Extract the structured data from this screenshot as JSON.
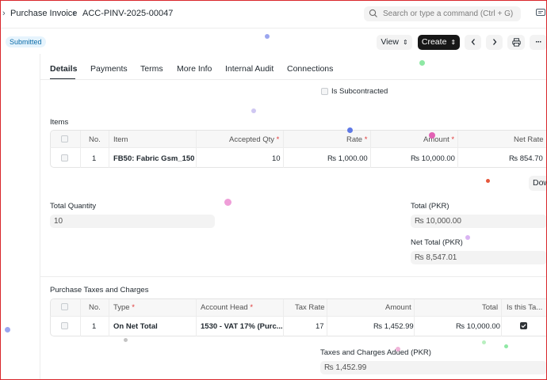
{
  "breadcrumb": {
    "doctype": "Purchase Invoice",
    "docname": "ACC-PINV-2025-00047"
  },
  "search": {
    "placeholder": "Search or type a command (Ctrl + G)"
  },
  "status": {
    "label": "Submitted"
  },
  "toolbar": {
    "view_label": "View",
    "create_label": "Create",
    "prev_icon": "chevron-left-icon",
    "next_icon": "chevron-right-icon",
    "print_icon": "printer-icon",
    "more_label": "···"
  },
  "tabs": [
    {
      "label": "Details",
      "active": true
    },
    {
      "label": "Payments"
    },
    {
      "label": "Terms"
    },
    {
      "label": "More Info"
    },
    {
      "label": "Internal Audit"
    },
    {
      "label": "Connections"
    }
  ],
  "is_subcontracted": {
    "label": "Is Subcontracted",
    "checked": false
  },
  "items": {
    "section_title": "Items",
    "headers": {
      "no": "No.",
      "item": "Item",
      "accepted_qty": "Accepted Qty",
      "rate": "Rate",
      "amount": "Amount",
      "net_rate": "Net Rate",
      "required_marker": "*"
    },
    "rows": [
      {
        "no": "1",
        "item": "FB50: Fabric Gsm_150",
        "accepted_qty": "10",
        "rate": "₨ 1,000.00",
        "amount": "₨ 10,000.00",
        "net_rate": "₨ 854.70"
      }
    ],
    "download_label": "Dow"
  },
  "totals": {
    "total_quantity_label": "Total Quantity",
    "total_quantity_value": "10",
    "total_label": "Total (PKR)",
    "total_value": "₨ 10,000.00",
    "net_total_label": "Net Total (PKR)",
    "net_total_value": "₨ 8,547.01"
  },
  "taxes": {
    "section_title": "Purchase Taxes and Charges",
    "headers": {
      "no": "No.",
      "type": "Type",
      "account_head": "Account Head",
      "tax_rate": "Tax Rate",
      "amount": "Amount",
      "total": "Total",
      "is_this_tax": "Is this Ta...",
      "required_marker": "*"
    },
    "rows": [
      {
        "no": "1",
        "type": "On Net Total",
        "account_head": "1530 - VAT 17% (Purc...",
        "tax_rate": "17",
        "amount": "₨ 1,452.99",
        "total": "₨ 10,000.00",
        "is_this_tax": true
      }
    ],
    "added_label": "Taxes and Charges Added (PKR)",
    "added_value": "₨ 1,452.99"
  },
  "colors": {
    "accent": "#171717",
    "badge_bg": "#e6f4fd",
    "badge_text": "#0b6ba8",
    "required": "#e03636"
  }
}
